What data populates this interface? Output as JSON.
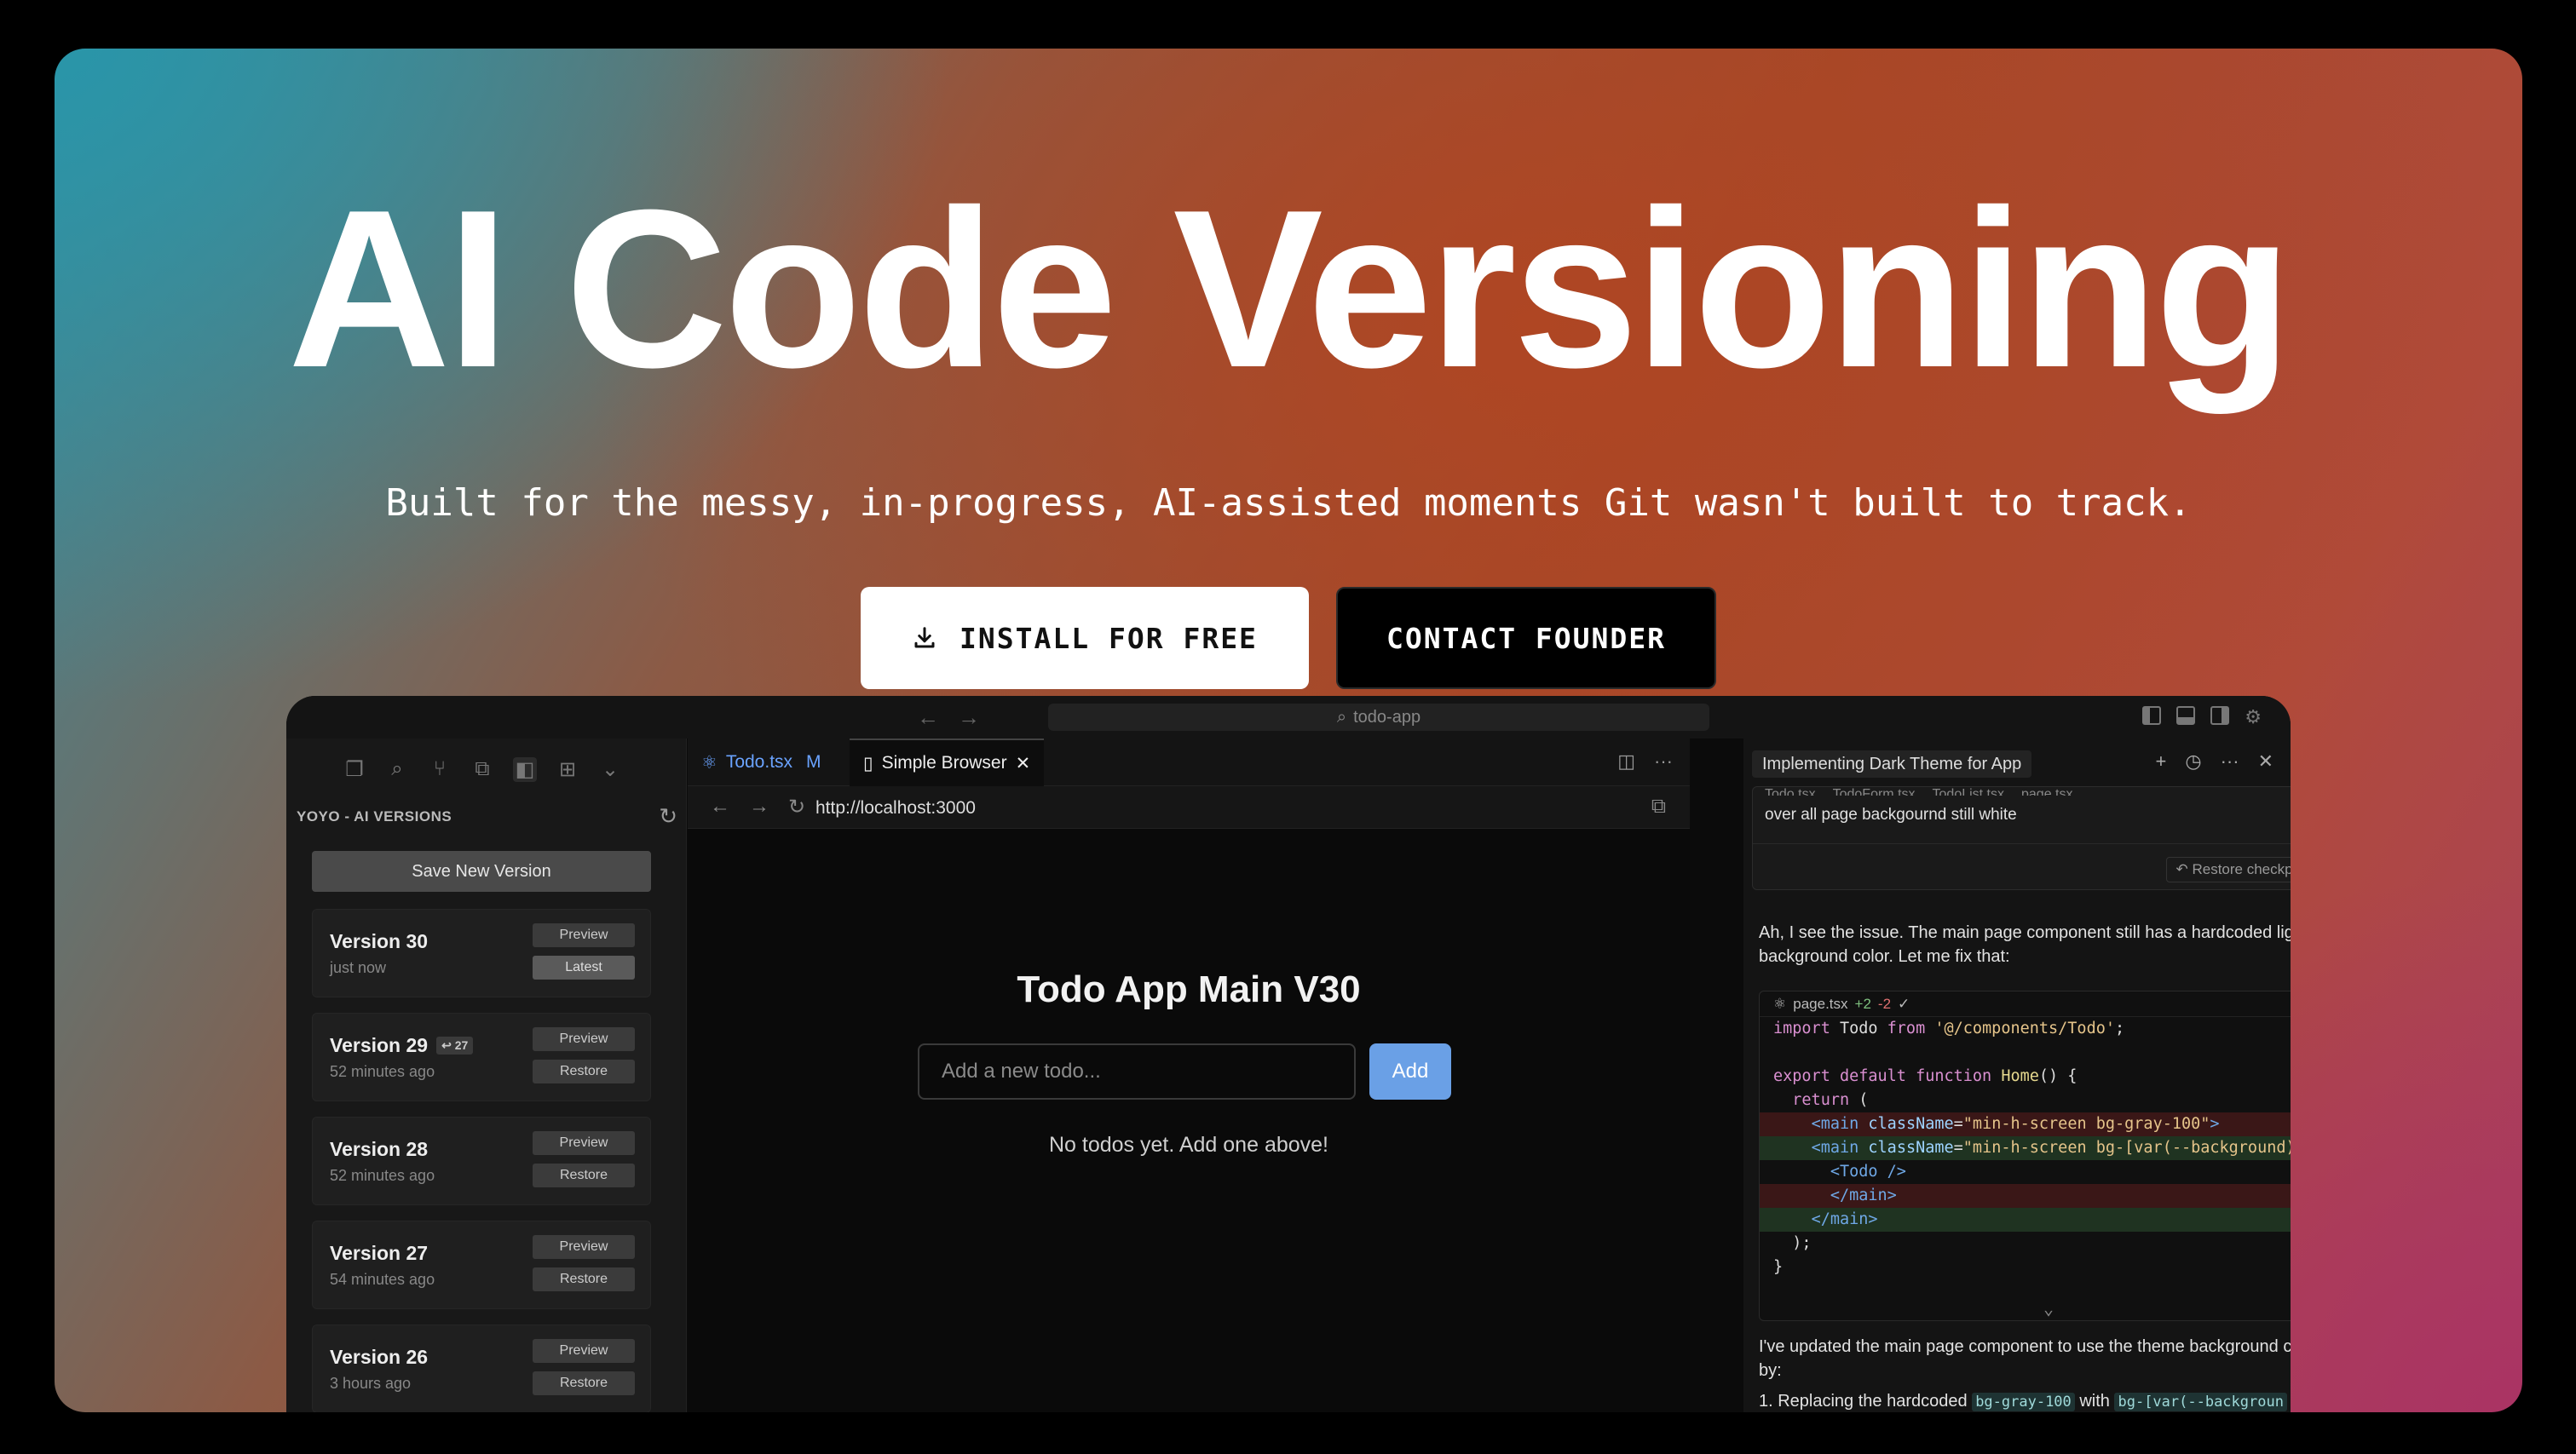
{
  "hero": {
    "title": "AI Code Versioning",
    "subtitle": "Built for the messy, in-progress, AI-assisted moments Git wasn't built to track.",
    "install_label": "INSTALL FOR FREE",
    "contact_label": "CONTACT FOUNDER"
  },
  "app": {
    "search_placeholder": "todo-app",
    "sidebar": {
      "heading": "YOYO - AI VERSIONS",
      "save_label": "Save New Version",
      "versions": [
        {
          "name": "Version 30",
          "time": "just now",
          "top_btn": "Preview",
          "bottom_btn": "Latest",
          "badge": ""
        },
        {
          "name": "Version 29",
          "time": "52 minutes ago",
          "top_btn": "Preview",
          "bottom_btn": "Restore",
          "badge": "↩ 27"
        },
        {
          "name": "Version 28",
          "time": "52 minutes ago",
          "top_btn": "Preview",
          "bottom_btn": "Restore",
          "badge": ""
        },
        {
          "name": "Version 27",
          "time": "54 minutes ago",
          "top_btn": "Preview",
          "bottom_btn": "Restore",
          "badge": ""
        },
        {
          "name": "Version 26",
          "time": "3 hours ago",
          "top_btn": "Preview",
          "bottom_btn": "Restore",
          "badge": ""
        }
      ]
    },
    "tabs": [
      {
        "label": "Todo.tsx",
        "modified": "M"
      },
      {
        "label": "Simple Browser"
      }
    ],
    "browser": {
      "url": "http://localhost:3000",
      "todo_title": "Todo App Main V30",
      "input_placeholder": "Add a new todo...",
      "add_label": "Add",
      "empty_text": "No todos yet. Add one above!"
    },
    "chat": {
      "title": "Implementing Dark Theme for App",
      "file_chips": [
        "Todo.tsx",
        "TodoForm.tsx",
        "TodoList.tsx",
        "page.tsx"
      ],
      "user_message": "over all page backgournd still white",
      "restore_label": "Restore checkpoint",
      "reply": "Ah, I see the issue. The main page component still has a hardcoded light background color. Let me fix that:",
      "code_file": "page.tsx",
      "code_added": "+2",
      "code_removed": "-2",
      "summary_intro": "I've updated the main page component to use the theme background color by:",
      "summary_item_prefix": "1. Replacing the hardcoded",
      "summary_item_code1": "bg-gray-100",
      "summary_item_with": "with",
      "summary_item_code2": "bg-[var(--backgroun"
    }
  }
}
